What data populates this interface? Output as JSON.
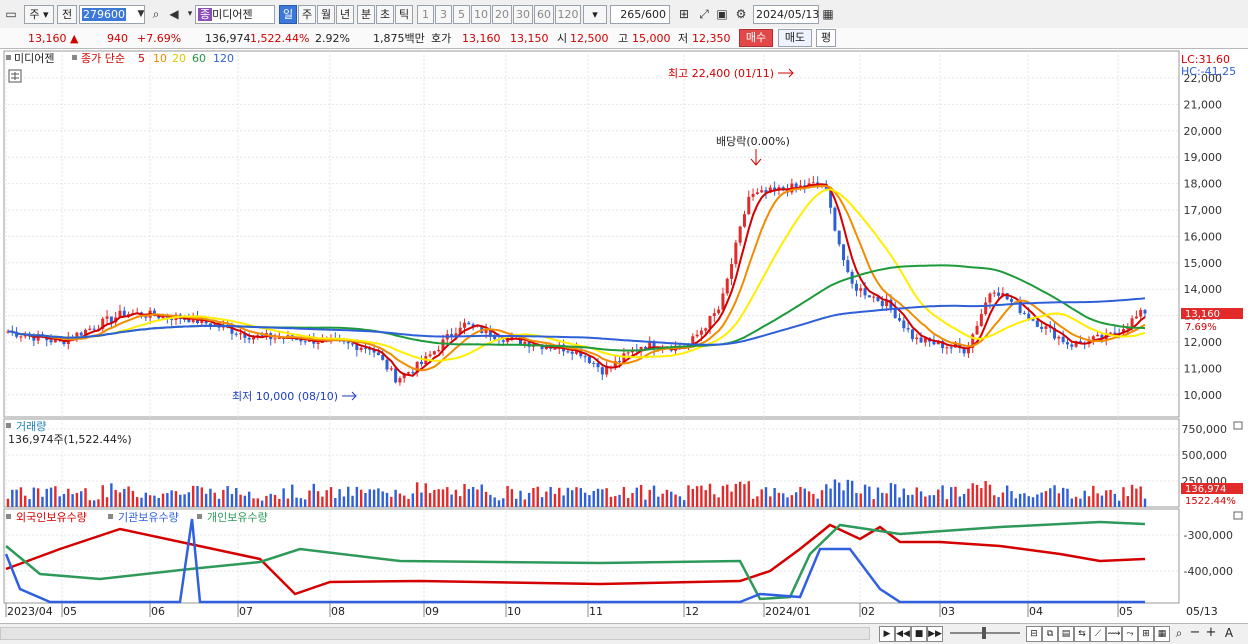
{
  "toolbar": {
    "market": "주",
    "type": "전",
    "code": "279600",
    "stock_badge": "종",
    "stock_name": "미디어젠",
    "periods": [
      "일",
      "주",
      "월",
      "년",
      "분",
      "초",
      "틱"
    ],
    "active_period": "일",
    "nums": [
      "1",
      "3",
      "5",
      "10",
      "20",
      "30",
      "60",
      "120"
    ],
    "count": "265",
    "count_total": "/600",
    "date": "2024/05/13"
  },
  "quote": {
    "price": "13,160",
    "change": "940",
    "change_pct": "+7.69%",
    "volume": "136,974",
    "volume_pct": "1,522.44%",
    "turnover": "2.92%",
    "amount": "1,875백만",
    "ask_label": "호가",
    "ask": "13,160",
    "bid": "13,150",
    "open_label": "시",
    "open": "12,500",
    "high_label": "고",
    "high": "15,000",
    "low_label": "저",
    "low": "12,350",
    "buy_label": "매수",
    "sell_label": "매도",
    "eval_label": "평"
  },
  "price_panel": {
    "legend_name": "미디어젠",
    "legend_ma": "종가 단순",
    "ma_periods": [
      "5",
      "10",
      "20",
      "60",
      "120"
    ],
    "lc": "LC:31.60",
    "hc": "HC:-41.25",
    "yaxis": [
      "22,000",
      "21,000",
      "20,000",
      "19,000",
      "18,000",
      "17,000",
      "16,000",
      "15,000",
      "14,000",
      "13,000",
      "12,000",
      "11,000",
      "10,000"
    ],
    "current_price": "13,160",
    "current_pct": "7.69%",
    "high_annotation": "최고 22,400 (01/11)",
    "low_annotation": "최저 10,000 (08/10)",
    "dividend_annotation": "배당락(0.00%)"
  },
  "volume_panel": {
    "title": "거래량",
    "value_text": "136,974주(1,522.44%)",
    "yaxis": [
      "750,000",
      "500,000",
      "250,000"
    ],
    "current": "136,974",
    "current_pct": "1522.44%"
  },
  "holding_panel": {
    "legends": [
      "외국인보유수량",
      "기관보유수량",
      "개인보유수량"
    ],
    "yaxis": [
      "-300,000",
      "-400,000"
    ]
  },
  "xaxis": [
    "2023/04",
    "05",
    "06",
    "07",
    "08",
    "09",
    "10",
    "11",
    "12",
    "2024/01",
    "02",
    "03",
    "04",
    "05"
  ],
  "xaxis_end": "05/13",
  "colors": {
    "ma5": "#d40000",
    "ma10": "#f08c00",
    "ma20": "#ffee00",
    "ma60": "#1f9a3a",
    "ma120": "#2f5fd8",
    "foreign": "#d40000",
    "institution": "#3060e0",
    "individual": "#2e9a5a"
  }
}
